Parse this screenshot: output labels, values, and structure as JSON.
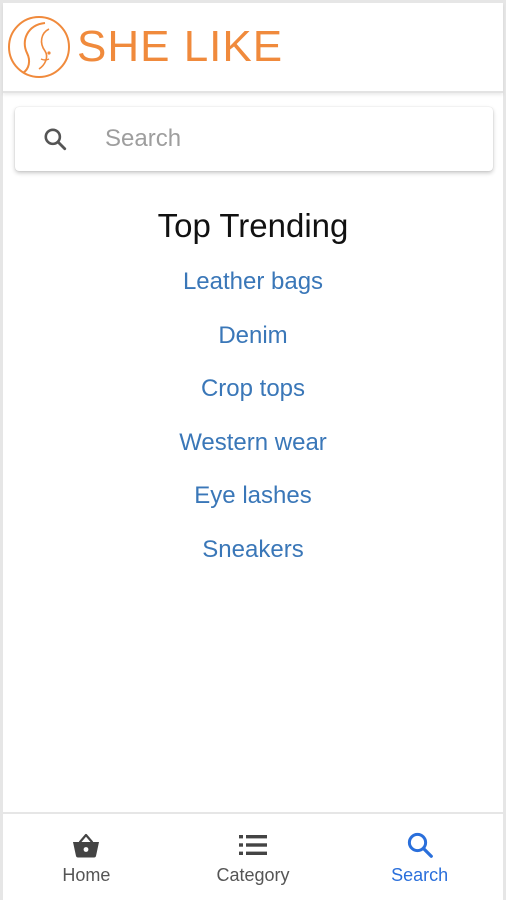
{
  "header": {
    "brand": "SHE LIKE"
  },
  "search": {
    "placeholder": "Search"
  },
  "trending": {
    "title": "Top Trending",
    "items": [
      "Leather bags",
      "Denim",
      "Crop tops",
      "Western wear",
      "Eye lashes",
      "Sneakers"
    ]
  },
  "bottom_nav": {
    "items": [
      {
        "label": "Home",
        "icon": "basket-icon"
      },
      {
        "label": "Category",
        "icon": "list-icon"
      },
      {
        "label": "Search",
        "icon": "search-icon",
        "active": true
      }
    ]
  },
  "colors": {
    "brand": "#f08a3c",
    "link": "#3a77b8",
    "active": "#2a6fdb"
  }
}
